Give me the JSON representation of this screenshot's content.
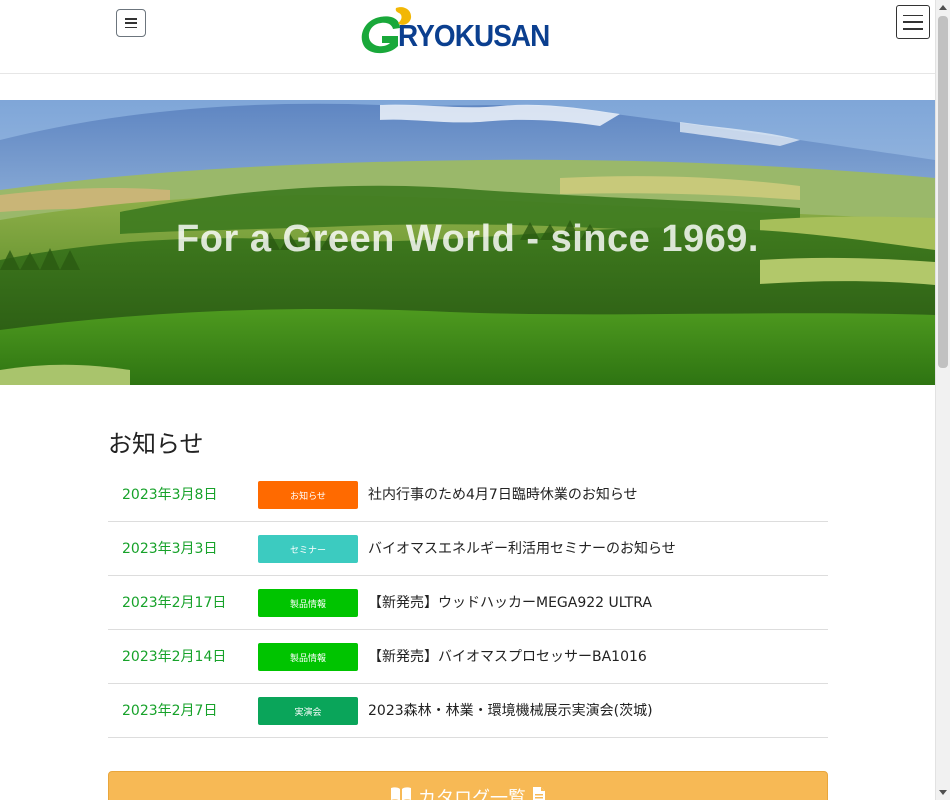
{
  "header": {
    "menu_small_label": "menu",
    "logo_text": "RYOKUSAN",
    "menu_label": "menu"
  },
  "hero": {
    "tagline": "For a Green World - since 1969."
  },
  "news": {
    "title": "お知らせ",
    "items": [
      {
        "date": "2023年3月8日",
        "badge": "お知らせ",
        "badge_color": "#ff6a00",
        "text": "社内行事のため4月7日臨時休業のお知らせ"
      },
      {
        "date": "2023年3月3日",
        "badge": "セミナー",
        "badge_color": "#3ccbc0",
        "text": "バイオマスエネルギー利活用セミナーのお知らせ"
      },
      {
        "date": "2023年2月17日",
        "badge": "製品情報",
        "badge_color": "#00c400",
        "text": "【新発売】ウッドハッカーMEGA922 ULTRA"
      },
      {
        "date": "2023年2月14日",
        "badge": "製品情報",
        "badge_color": "#00c400",
        "text": "【新発売】バイオマスプロセッサーBA1016"
      },
      {
        "date": "2023年2月7日",
        "badge": "実演会",
        "badge_color": "#0aa55a",
        "text": "2023森林・林業・環境機械展示実演会(茨城)"
      }
    ]
  },
  "catalog": {
    "label": "カタログ一覧",
    "icon_left": "book-icon",
    "icon_right": "document-icon",
    "color": "#f7b955"
  },
  "colors": {
    "date_green": "#17a22a",
    "logo_blue": "#0b3f8f",
    "logo_green": "#19a83a",
    "logo_yellow": "#f2b705"
  }
}
